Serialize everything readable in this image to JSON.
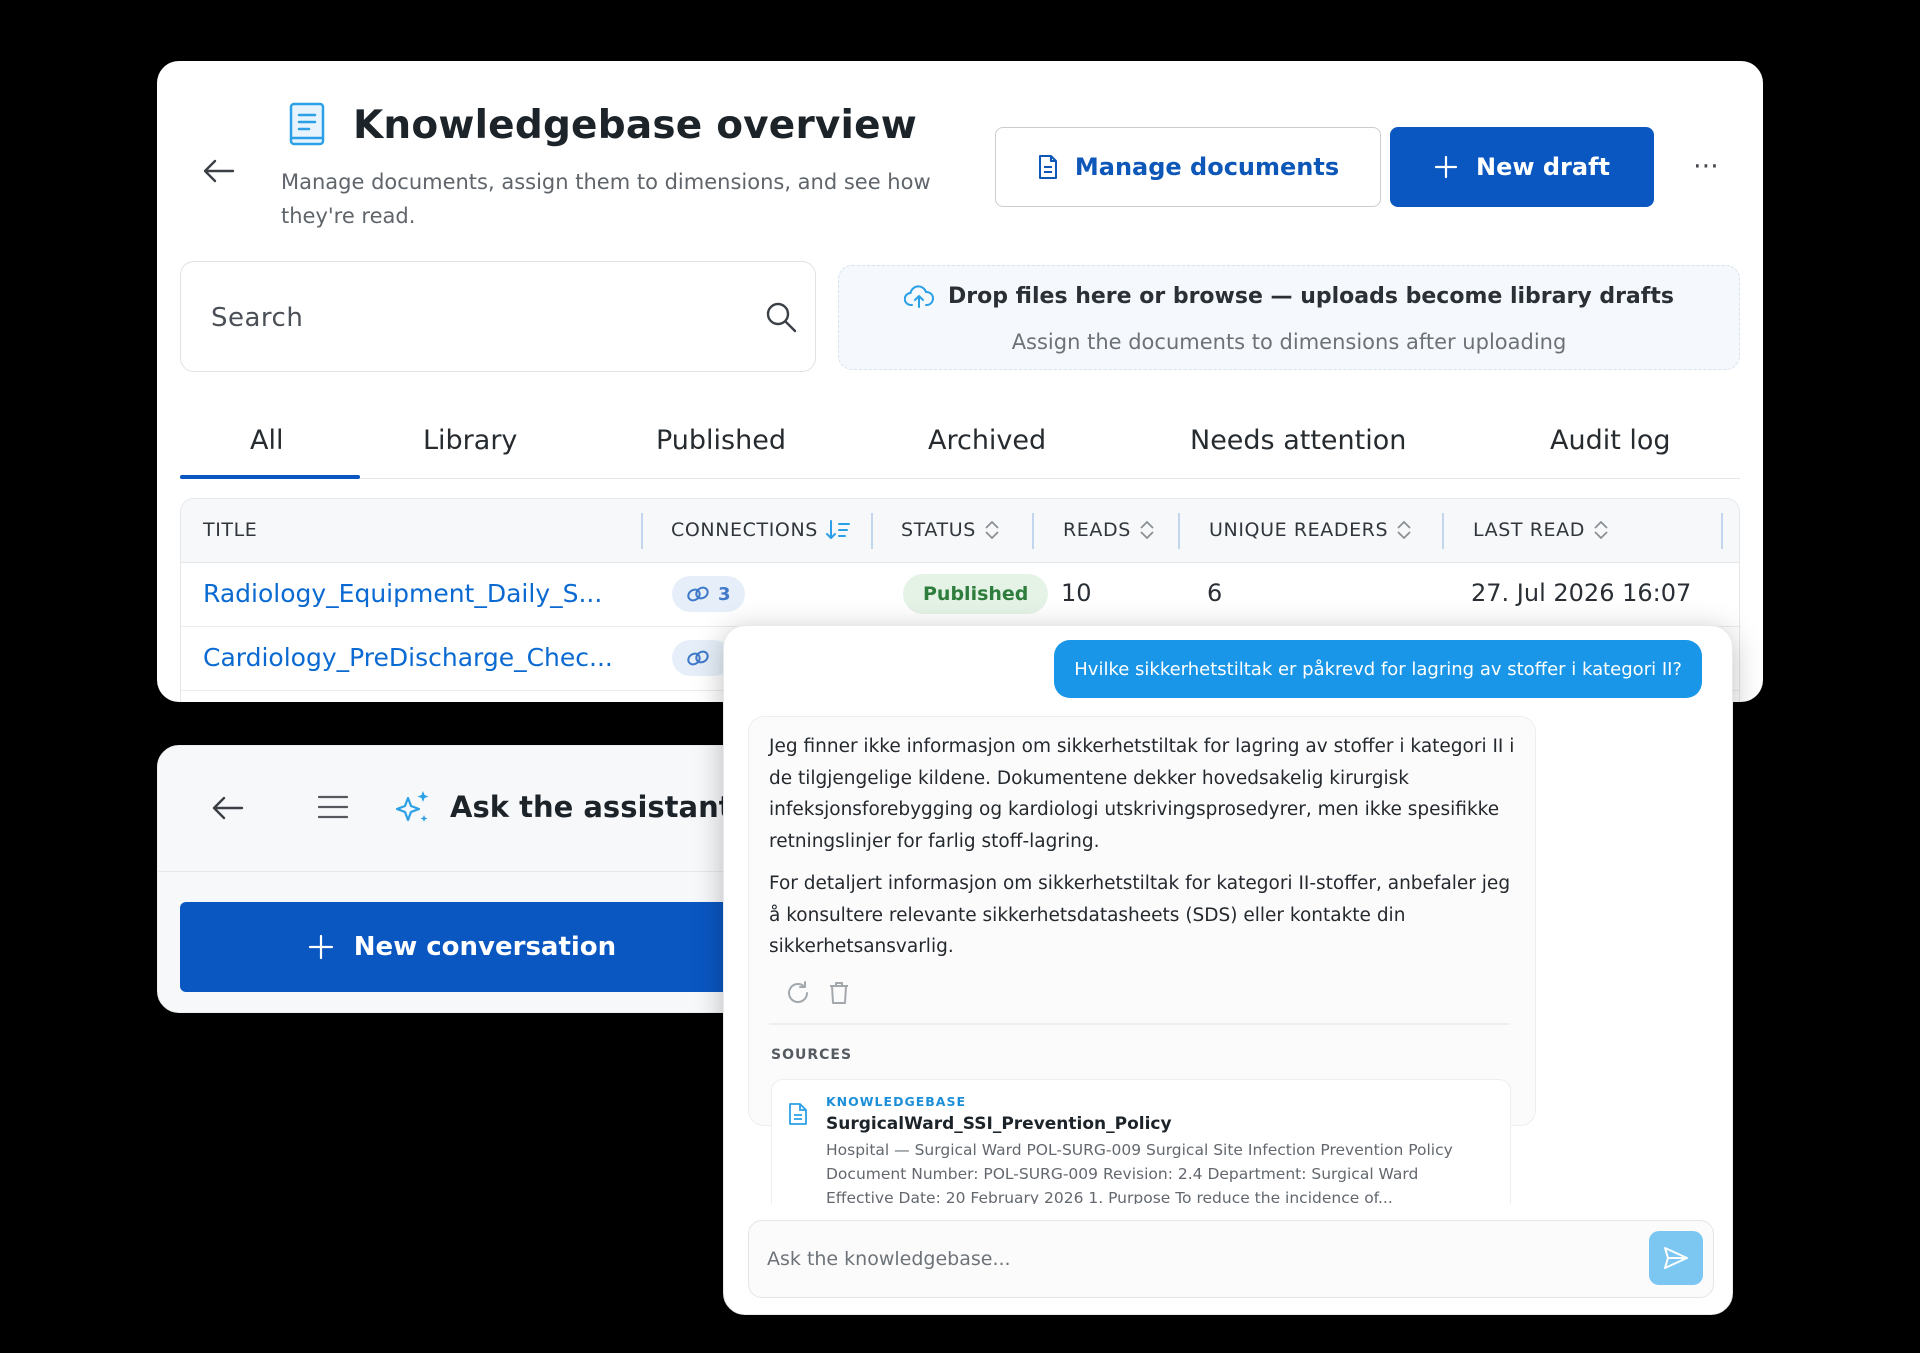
{
  "knowledgebase": {
    "title": "Knowledgebase overview",
    "subtitle": "Manage documents, assign them to dimensions, and see how they're read.",
    "manage_documents_label": "Manage documents",
    "new_draft_label": "New draft",
    "more_label": "⋯",
    "search": {
      "placeholder": "Search",
      "value": ""
    },
    "dropzone": {
      "title": "Drop files here or browse — uploads become library drafts",
      "subtitle": "Assign the documents to dimensions after uploading"
    },
    "tabs": [
      {
        "label": "All",
        "active": true
      },
      {
        "label": "Library"
      },
      {
        "label": "Published"
      },
      {
        "label": "Archived"
      },
      {
        "label": "Needs attention"
      },
      {
        "label": "Audit log"
      }
    ],
    "table": {
      "columns": [
        "TITLE",
        "CONNECTIONS",
        "STATUS",
        "READS",
        "UNIQUE READERS",
        "LAST READ"
      ],
      "rows": [
        {
          "title": "Radiology_Equipment_Daily_S...",
          "connections": "3",
          "status": "Published",
          "reads": "10",
          "unique_readers": "6",
          "last_read": "27. Jul 2026 16:07"
        },
        {
          "title": "Cardiology_PreDischarge_Chec...",
          "connections": "",
          "status": "",
          "reads": "",
          "unique_readers": "",
          "last_read": ""
        }
      ]
    }
  },
  "assistant": {
    "title": "Ask the assistant",
    "new_conversation_label": "New conversation"
  },
  "chat": {
    "user_message": "Hvilke sikkerhetstiltak er påkrevd for lagring av stoffer i kategori II?",
    "assistant_paragraphs": [
      "Jeg finner ikke informasjon om sikkerhetstiltak for lagring av stoffer i kategori II i de tilgjengelige kildene. Dokumentene dekker hovedsakelig kirurgisk infeksjonsforebygging og kardiologi utskrivingsprosedyrer, men ikke spesifikke retningslinjer for farlig stoff-lagring.",
      "For detaljert informasjon om sikkerhetstiltak for kategori II-stoffer, anbefaler jeg å konsultere relevante sikkerhetsdatasheets (SDS) eller kontakte din sikkerhetsansvarlig."
    ],
    "sources_label": "SOURCES",
    "source": {
      "kind": "KNOWLEDGEBASE",
      "name": "SurgicalWard_SSI_Prevention_Policy",
      "snippet": "Hospital — Surgical Ward POL-SURG-009 Surgical Site Infection Prevention Policy Document Number: POL-SURG-009 Revision: 2.4 Department: Surgical Ward Effective Date: 20 February 2026 1. Purpose To reduce the incidence of..."
    },
    "input": {
      "placeholder": "Ask the knowledgebase...",
      "value": ""
    }
  },
  "colors": {
    "primary": "#0a57c2",
    "link": "#0a6ad1",
    "user_bubble": "#1996e8",
    "published_bg": "#e5f3e7",
    "published_text": "#2f7d3c"
  },
  "icons": [
    "back-arrow-icon",
    "book-icon",
    "document-icon",
    "plus-icon",
    "more-icon",
    "search-icon",
    "cloud-upload-icon",
    "sort-icon",
    "link-icon",
    "menu-icon",
    "sparkle-icon",
    "refresh-icon",
    "trash-icon",
    "send-icon"
  ]
}
